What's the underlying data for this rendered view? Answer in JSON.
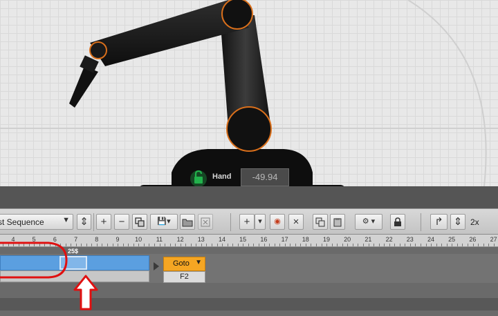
{
  "viewport": {
    "hand_label": "Hand",
    "hand_value": "-49.94",
    "lock_state": "unlocked",
    "accent_color": "#d96f1b",
    "lock_color": "#22b24c"
  },
  "toolbar": {
    "sequence_select_text": "st Sequence",
    "sequence_select_arrow": "▼",
    "stepper_glyph": "⇕",
    "add_label": "+",
    "remove_label": "−",
    "duplicate_icon": "duplicate-icon",
    "save_label": "💾▾",
    "open_icon": "folder-open-icon",
    "close_file_icon": "close-file-icon",
    "insert_label": "+",
    "insert_arrow": "▾",
    "record_label": "◉",
    "delete_label": "×",
    "copy_icon": "copy-icon",
    "paste_icon": "paste-icon",
    "settings_label": "⚙ ▾",
    "lock_icon": "padlock-icon",
    "loop_label": "↱",
    "speed_stepper": "⇕",
    "speed_text": "2x"
  },
  "ruler": {
    "labels": [
      "4",
      "5",
      "6",
      "7",
      "8",
      "9",
      "10",
      "11",
      "12",
      "13",
      "14",
      "15",
      "16",
      "17",
      "18",
      "19",
      "20",
      "21",
      "22",
      "23",
      "24",
      "25",
      "26",
      "27"
    ]
  },
  "timeline": {
    "playhead_label": "25$",
    "goto_label": "Goto",
    "goto_arrow": "▼",
    "goto_value": "F2",
    "sequence_color": "#5b9fe0",
    "goto_color": "#f5a623"
  },
  "annotation": {
    "highlight_color": "#e01010"
  }
}
